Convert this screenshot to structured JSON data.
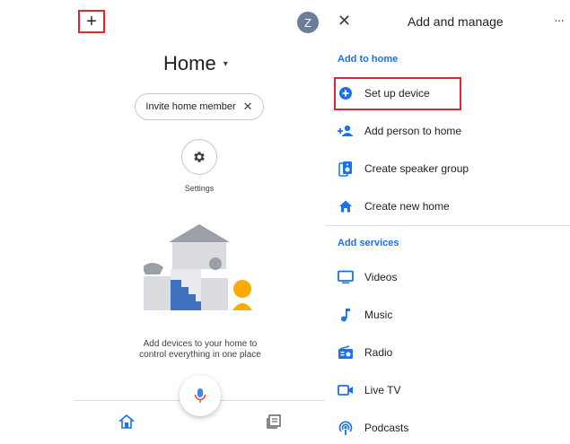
{
  "left": {
    "add_symbol": "+",
    "avatar_initial": "Z",
    "home_title": "Home",
    "caret": "▾",
    "invite_chip": {
      "label": "Invite home member",
      "close": "✕"
    },
    "settings_label": "Settings",
    "empty_message": "Add devices to your home to control everything in one place"
  },
  "right": {
    "close_symbol": "✕",
    "title": "Add and manage",
    "more_symbol": "···",
    "section_add_to_home": "Add to home",
    "add_to_home_items": [
      {
        "label": "Set up device",
        "icon": "add-circle-icon"
      },
      {
        "label": "Add person to home",
        "icon": "person-add-icon"
      },
      {
        "label": "Create speaker group",
        "icon": "speaker-group-icon"
      },
      {
        "label": "Create new home",
        "icon": "home-icon"
      }
    ],
    "section_add_services": "Add services",
    "add_services_items": [
      {
        "label": "Videos",
        "icon": "tv-icon"
      },
      {
        "label": "Music",
        "icon": "music-note-icon"
      },
      {
        "label": "Radio",
        "icon": "radio-icon"
      },
      {
        "label": "Live TV",
        "icon": "live-tv-icon"
      },
      {
        "label": "Podcasts",
        "icon": "podcasts-icon"
      }
    ]
  },
  "colors": {
    "accent": "#1a73e8",
    "highlight": "#e0262f"
  }
}
